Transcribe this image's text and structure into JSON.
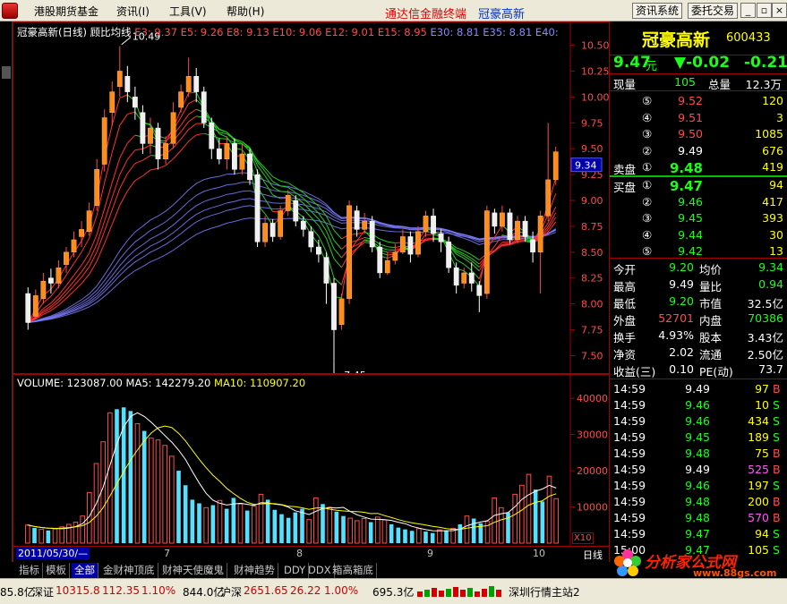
{
  "menu": {
    "items": [
      "港股期货基金",
      "资讯(I)",
      "工具(V)",
      "帮助(H)"
    ],
    "center_title": "通达信金融终端",
    "stock_title": "冠豪高新",
    "right_buttons": [
      "资讯系统",
      "委托交易"
    ]
  },
  "chart_header": {
    "name": "冠豪高新(日线)",
    "indicator": "顾比均线",
    "mas": [
      {
        "label": "E3: 9.37",
        "color": "#ff4b4b"
      },
      {
        "label": "E5: 9.26",
        "color": "#ff4b4b"
      },
      {
        "label": "E8: 9.13",
        "color": "#ff4b4b"
      },
      {
        "label": "E10: 9.06",
        "color": "#ff4b4b"
      },
      {
        "label": "E12: 9.01",
        "color": "#ff4b4b"
      },
      {
        "label": "E15: 8.95",
        "color": "#ff4b4b"
      },
      {
        "label": "E30: 8.81",
        "color": "#8888ff"
      },
      {
        "label": "E35: 8.81",
        "color": "#8888ff"
      },
      {
        "label": "E40:",
        "color": "#8888ff"
      }
    ],
    "high_label": "10.49",
    "low_label": "7.45",
    "current_price_tag": "9.34"
  },
  "price_axis": [
    "10.50",
    "10.25",
    "10.00",
    "9.75",
    "9.50",
    "9.25",
    "9.00",
    "8.75",
    "8.50",
    "8.25",
    "8.00",
    "7.75",
    "7.50"
  ],
  "volume_header": {
    "volume": "VOLUME: 123087.00",
    "ma5": "MA5: 142279.20",
    "ma10": "MA10: 110907.20"
  },
  "volume_axis": [
    "40000",
    "30000",
    "20000",
    "10000"
  ],
  "x_axis": {
    "date_label": "2011/05/30/—",
    "months": [
      "7",
      "8",
      "9",
      "10"
    ],
    "multiplier": "X10",
    "period_label": "日线"
  },
  "chart_data": {
    "type": "candlestick",
    "ylim": [
      7.4,
      10.6
    ],
    "candles": [
      [
        8.1,
        7.82,
        8.16,
        7.75
      ],
      [
        7.88,
        8.08,
        8.14,
        7.85
      ],
      [
        8.05,
        8.22,
        8.3,
        8.0
      ],
      [
        8.25,
        8.2,
        8.34,
        8.1
      ],
      [
        8.2,
        8.35,
        8.42,
        8.15
      ],
      [
        8.38,
        8.5,
        8.55,
        8.3
      ],
      [
        8.5,
        8.62,
        8.7,
        8.45
      ],
      [
        8.65,
        8.72,
        8.8,
        8.55
      ],
      [
        8.7,
        8.9,
        8.98,
        8.66
      ],
      [
        8.95,
        9.3,
        9.4,
        8.9
      ],
      [
        9.35,
        9.8,
        9.88,
        9.28
      ],
      [
        9.85,
        10.05,
        10.15,
        9.72
      ],
      [
        10.1,
        10.25,
        10.49,
        10.0
      ],
      [
        10.2,
        10.05,
        10.3,
        9.95
      ],
      [
        10.0,
        9.9,
        10.1,
        9.78
      ],
      [
        9.85,
        9.55,
        9.92,
        9.45
      ],
      [
        9.55,
        9.7,
        9.8,
        9.45
      ],
      [
        9.7,
        9.4,
        9.75,
        9.3
      ],
      [
        9.4,
        9.55,
        9.62,
        9.35
      ],
      [
        9.55,
        9.85,
        9.95,
        9.5
      ],
      [
        9.9,
        10.05,
        10.12,
        9.85
      ],
      [
        10.05,
        10.2,
        10.38,
        10.0
      ],
      [
        10.2,
        10.05,
        10.28,
        9.95
      ],
      [
        10.05,
        9.75,
        10.1,
        9.7
      ],
      [
        9.75,
        9.5,
        9.8,
        9.4
      ],
      [
        9.5,
        9.4,
        9.6,
        9.35
      ],
      [
        9.4,
        9.55,
        9.62,
        9.3
      ],
      [
        9.55,
        9.3,
        9.6,
        9.25
      ],
      [
        9.3,
        9.45,
        9.55,
        9.25
      ],
      [
        9.45,
        9.2,
        9.5,
        9.15
      ],
      [
        9.25,
        8.6,
        9.3,
        8.55
      ],
      [
        8.6,
        8.78,
        8.85,
        8.55
      ],
      [
        8.78,
        8.65,
        8.82,
        8.6
      ],
      [
        8.65,
        8.9,
        8.95,
        8.62
      ],
      [
        8.9,
        9.05,
        9.1,
        8.85
      ],
      [
        9.0,
        8.8,
        9.05,
        8.75
      ],
      [
        8.8,
        8.72,
        8.85,
        8.65
      ],
      [
        8.7,
        8.55,
        8.75,
        8.5
      ],
      [
        8.55,
        8.48,
        8.62,
        8.4
      ],
      [
        8.45,
        8.2,
        8.5,
        8.0
      ],
      [
        8.2,
        7.75,
        8.25,
        7.45
      ],
      [
        7.8,
        8.05,
        8.1,
        7.75
      ],
      [
        8.05,
        8.95,
        9.0,
        8.0
      ],
      [
        8.9,
        8.72,
        8.95,
        8.65
      ],
      [
        8.72,
        8.8,
        8.88,
        8.68
      ],
      [
        8.8,
        8.55,
        8.85,
        8.5
      ],
      [
        8.55,
        8.3,
        8.6,
        8.25
      ],
      [
        8.3,
        8.42,
        8.5,
        8.28
      ],
      [
        8.42,
        8.5,
        8.58,
        8.38
      ],
      [
        8.5,
        8.65,
        8.72,
        8.48
      ],
      [
        8.65,
        8.48,
        8.7,
        8.4
      ],
      [
        8.48,
        8.7,
        8.75,
        8.45
      ],
      [
        8.7,
        8.85,
        8.9,
        8.65
      ],
      [
        8.85,
        8.68,
        8.92,
        8.6
      ],
      [
        8.68,
        8.6,
        8.72,
        8.5
      ],
      [
        8.6,
        8.35,
        8.65,
        8.3
      ],
      [
        8.35,
        8.18,
        8.4,
        8.1
      ],
      [
        8.2,
        8.3,
        8.35,
        8.15
      ],
      [
        8.3,
        8.2,
        8.4,
        8.12
      ],
      [
        8.18,
        8.08,
        8.22,
        7.92
      ],
      [
        8.1,
        8.9,
        8.95,
        8.05
      ],
      [
        8.88,
        8.75,
        8.92,
        8.68
      ],
      [
        8.75,
        8.88,
        8.95,
        8.7
      ],
      [
        8.88,
        8.62,
        8.92,
        8.58
      ],
      [
        8.62,
        8.8,
        8.85,
        8.58
      ],
      [
        8.8,
        8.65,
        8.85,
        8.6
      ],
      [
        8.62,
        8.5,
        8.7,
        8.4
      ],
      [
        8.5,
        8.85,
        8.9,
        8.1
      ],
      [
        8.85,
        9.2,
        9.75,
        8.8
      ],
      [
        9.2,
        9.47,
        9.52,
        9.15
      ]
    ],
    "volumes": [
      5000,
      4200,
      3800,
      3500,
      3900,
      4500,
      5200,
      5800,
      7500,
      14000,
      22000,
      28000,
      36000,
      37000,
      37500,
      36500,
      33000,
      31000,
      29000,
      28500,
      27000,
      24000,
      20000,
      16000,
      12000,
      11000,
      9800,
      10500,
      11800,
      9500,
      12500,
      10800,
      9000,
      10200,
      13500,
      12000,
      9200,
      8000,
      7000,
      8500,
      9500,
      6500,
      12500,
      10800,
      9900,
      8700,
      7500,
      6900,
      6200,
      6800,
      5800,
      7200,
      6400,
      5200,
      4300,
      3800,
      3400,
      4000,
      3200,
      2800,
      3700,
      3500,
      4100,
      5200,
      7500,
      6800,
      5500,
      6000,
      12500,
      9800,
      8500,
      13500,
      16000,
      19000,
      14800,
      11500,
      18500,
      12300
    ],
    "vol_ylim": [
      0,
      43000
    ]
  },
  "quote": {
    "name": "冠豪高新",
    "code": "600433",
    "price": "9.47",
    "price_unit": "元",
    "change": "▼-0.02",
    "change_pct": "-0.21",
    "now_vol_label": "现量",
    "now_vol": "105",
    "total_vol_label": "总量",
    "total_vol": "12.3万",
    "sell_label": "卖盘",
    "buy_label": "买盘",
    "asks": [
      {
        "idx": "⑤",
        "price": "9.52",
        "vol": "120",
        "pcolor": "red"
      },
      {
        "idx": "④",
        "price": "9.51",
        "vol": "3",
        "pcolor": "red"
      },
      {
        "idx": "③",
        "price": "9.50",
        "vol": "1085",
        "pcolor": "red"
      },
      {
        "idx": "②",
        "price": "9.49",
        "vol": "676",
        "pcolor": "white"
      },
      {
        "idx": "①",
        "price": "9.48",
        "vol": "419",
        "pcolor": "green"
      }
    ],
    "bids": [
      {
        "idx": "①",
        "price": "9.47",
        "vol": "94"
      },
      {
        "idx": "②",
        "price": "9.46",
        "vol": "417"
      },
      {
        "idx": "③",
        "price": "9.45",
        "vol": "393"
      },
      {
        "idx": "④",
        "price": "9.44",
        "vol": "30"
      },
      {
        "idx": "⑤",
        "price": "9.42",
        "vol": "13"
      }
    ],
    "stats": [
      {
        "l1": "今开",
        "v1": "9.20",
        "c1": "green",
        "l2": "均价",
        "v2": "9.34",
        "c2": "green"
      },
      {
        "l1": "最高",
        "v1": "9.49",
        "c1": "white",
        "l2": "量比",
        "v2": "0.94",
        "c2": "green"
      },
      {
        "l1": "最低",
        "v1": "9.20",
        "c1": "green",
        "l2": "市值",
        "v2": "32.5亿",
        "c2": "white"
      },
      {
        "l1": "外盘",
        "v1": "52701",
        "c1": "red",
        "l2": "内盘",
        "v2": "70386",
        "c2": "green"
      },
      {
        "l1": "换手",
        "v1": "4.93%",
        "c1": "white",
        "l2": "股本",
        "v2": "3.43亿",
        "c2": "white"
      },
      {
        "l1": "净资",
        "v1": "2.02",
        "c1": "white",
        "l2": "流通",
        "v2": "2.50亿",
        "c2": "white"
      },
      {
        "l1": "收益(三)",
        "v1": "0.10",
        "c1": "white",
        "l2": "PE(动)",
        "v2": "73.7",
        "c2": "white"
      }
    ],
    "ticks": [
      {
        "time": "14:59",
        "price": "9.49",
        "pc": "white",
        "vol": "97",
        "vc": "yellow",
        "bs": "B",
        "bc": "red"
      },
      {
        "time": "14:59",
        "price": "9.46",
        "pc": "green",
        "vol": "10",
        "vc": "yellow",
        "bs": "S",
        "bc": "green"
      },
      {
        "time": "14:59",
        "price": "9.46",
        "pc": "green",
        "vol": "434",
        "vc": "yellow",
        "bs": "S",
        "bc": "green"
      },
      {
        "time": "14:59",
        "price": "9.45",
        "pc": "green",
        "vol": "189",
        "vc": "yellow",
        "bs": "S",
        "bc": "green"
      },
      {
        "time": "14:59",
        "price": "9.48",
        "pc": "green",
        "vol": "75",
        "vc": "yellow",
        "bs": "B",
        "bc": "red"
      },
      {
        "time": "14:59",
        "price": "9.49",
        "pc": "white",
        "vol": "525",
        "vc": "purple",
        "bs": "B",
        "bc": "red"
      },
      {
        "time": "14:59",
        "price": "9.46",
        "pc": "green",
        "vol": "197",
        "vc": "yellow",
        "bs": "S",
        "bc": "green"
      },
      {
        "time": "14:59",
        "price": "9.48",
        "pc": "green",
        "vol": "200",
        "vc": "yellow",
        "bs": "B",
        "bc": "red"
      },
      {
        "time": "14:59",
        "price": "9.48",
        "pc": "green",
        "vol": "570",
        "vc": "purple",
        "bs": "B",
        "bc": "red"
      },
      {
        "time": "14:59",
        "price": "9.47",
        "pc": "green",
        "vol": "94",
        "vc": "yellow",
        "bs": "S",
        "bc": "green"
      },
      {
        "time": "15:00",
        "price": "9.47",
        "pc": "green",
        "vol": "105",
        "vc": "yellow",
        "bs": "S",
        "bc": "green"
      }
    ]
  },
  "tabs": [
    "指标",
    "模板",
    "全部",
    "金财神顶底",
    "财神天使魔鬼",
    "财神趋势",
    "DDY",
    "DDX",
    "箱高箱底"
  ],
  "statusbar": {
    "s0": "85.8亿",
    "s1_label": "深证",
    "s1_val": "10315.8",
    "s1_chg": "112.35",
    "s1_pct": "1.10%",
    "s2": "844.0亿",
    "s3_label": "沪深",
    "s3_val": "2651.65",
    "s3_chg": "26.22",
    "s3_pct": "1.00%",
    "s4": "695.3亿",
    "s5": "深圳行情主站2"
  },
  "watermark": {
    "name": "分析家公式网",
    "url": "www.88gs.com"
  }
}
